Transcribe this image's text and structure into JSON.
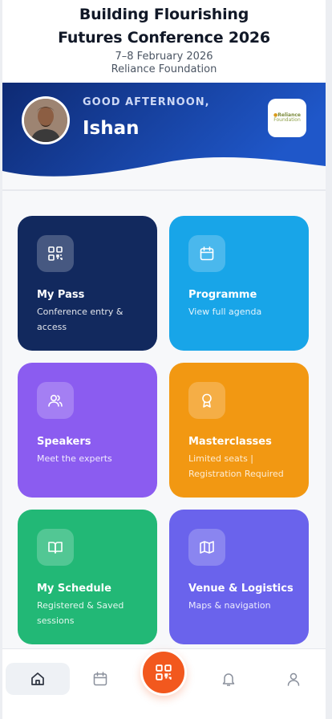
{
  "header": {
    "title_line1": "Building Flourishing",
    "title_line2": "Futures Conference 2026",
    "date": "7–8 February 2026",
    "organizer": "Reliance Foundation"
  },
  "hero": {
    "greeting": "GOOD AFTERNOON,",
    "user_name": "Ishan",
    "logo_text_line1": "Reliance",
    "logo_text_line2": "Foundation",
    "colors": {
      "gradient_start": "#0e2a73",
      "gradient_end": "#1f57c9"
    }
  },
  "cards": [
    {
      "key": "pass",
      "title": "My Pass",
      "subtitle": "Conference entry & access",
      "icon": "qr-code-icon",
      "color": "#12295e"
    },
    {
      "key": "programme",
      "title": "Programme",
      "subtitle": "View full agenda",
      "icon": "calendar-icon",
      "color": "#18a5e8"
    },
    {
      "key": "speakers",
      "title": "Speakers",
      "subtitle": "Meet the experts",
      "icon": "users-icon",
      "color": "#8b5cf0"
    },
    {
      "key": "masterclasses",
      "title": "Masterclasses",
      "subtitle": "Limited seats | Registration Required",
      "icon": "award-icon",
      "color": "#f29812"
    },
    {
      "key": "schedule",
      "title": "My Schedule",
      "subtitle": "Registered & Saved sessions",
      "icon": "book-icon",
      "color": "#22b876"
    },
    {
      "key": "venue",
      "title": "Venue & Logistics",
      "subtitle": "Maps & navigation",
      "icon": "map-icon",
      "color": "#6a63ec"
    }
  ],
  "bottom_nav": {
    "items": [
      "home-icon",
      "calendar-icon",
      "qr-code-icon",
      "bell-icon",
      "user-icon"
    ],
    "active": "home-icon",
    "accent": "#f2581e"
  }
}
